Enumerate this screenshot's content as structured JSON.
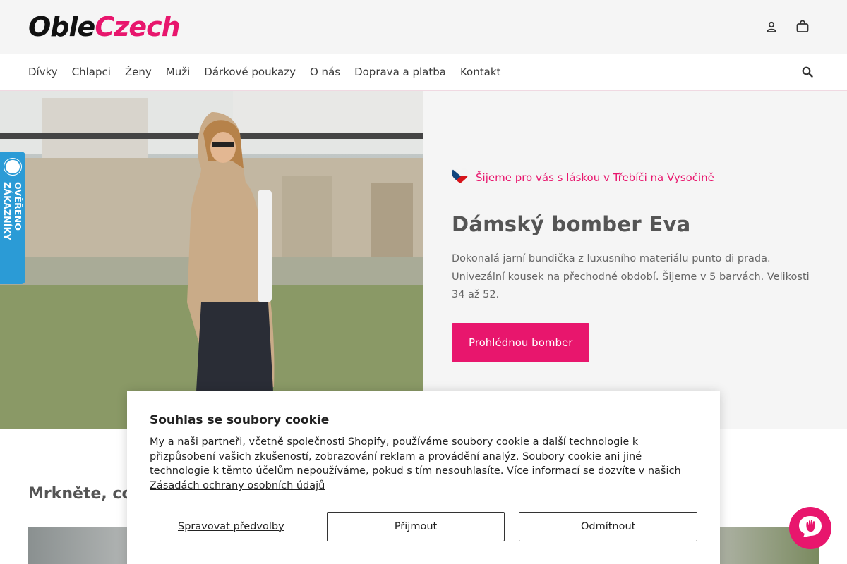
{
  "brand": {
    "logo_part1": "Oble",
    "logo_part2": "Czech"
  },
  "header": {
    "icons": [
      "user-icon",
      "cart-icon"
    ]
  },
  "nav": {
    "items": [
      {
        "label": "Dívky"
      },
      {
        "label": "Chlapci"
      },
      {
        "label": "Ženy"
      },
      {
        "label": "Muži"
      },
      {
        "label": "Dárkové poukazy"
      },
      {
        "label": "O nás"
      },
      {
        "label": "Doprava a platba"
      },
      {
        "label": "Kontakt"
      }
    ]
  },
  "badge": {
    "label": "OVĚŘENO ZÁKAZNÍKY"
  },
  "hero": {
    "tagline": "Šijeme pro vás s láskou v Třebíči na Vysočině",
    "title": "Dámský bomber Eva",
    "description": "Dokonalá jarní bundička z luxusního materiálu punto di prada. Univezální kousek na přechodné období. Šijeme v 5 barvách. Velikosti 34 až 52.",
    "cta_label": "Prohlédnou bomber"
  },
  "section": {
    "title": "Mrkněte, co"
  },
  "cookie": {
    "title": "Souhlas se soubory cookie",
    "text": "My a naši partneři, včetně společnosti Shopify, používáme soubory cookie a další technologie k přizpůsobení vašich zkušeností, zobrazování reklam a provádění analýz. Soubory cookie ani jiné technologie k těmto účelům nepoužíváme, pokud s tím nesouhlasíte. Více informací se dozvíte v našich",
    "link": "Zásadách ochrany osobních údajů",
    "manage_label": "Spravovat předvolby",
    "accept_label": "Přijmout",
    "decline_label": "Odmítnout"
  },
  "colors": {
    "accent": "#e8166d",
    "badge": "#2b9bd6",
    "panel": "#f5f5f5"
  }
}
